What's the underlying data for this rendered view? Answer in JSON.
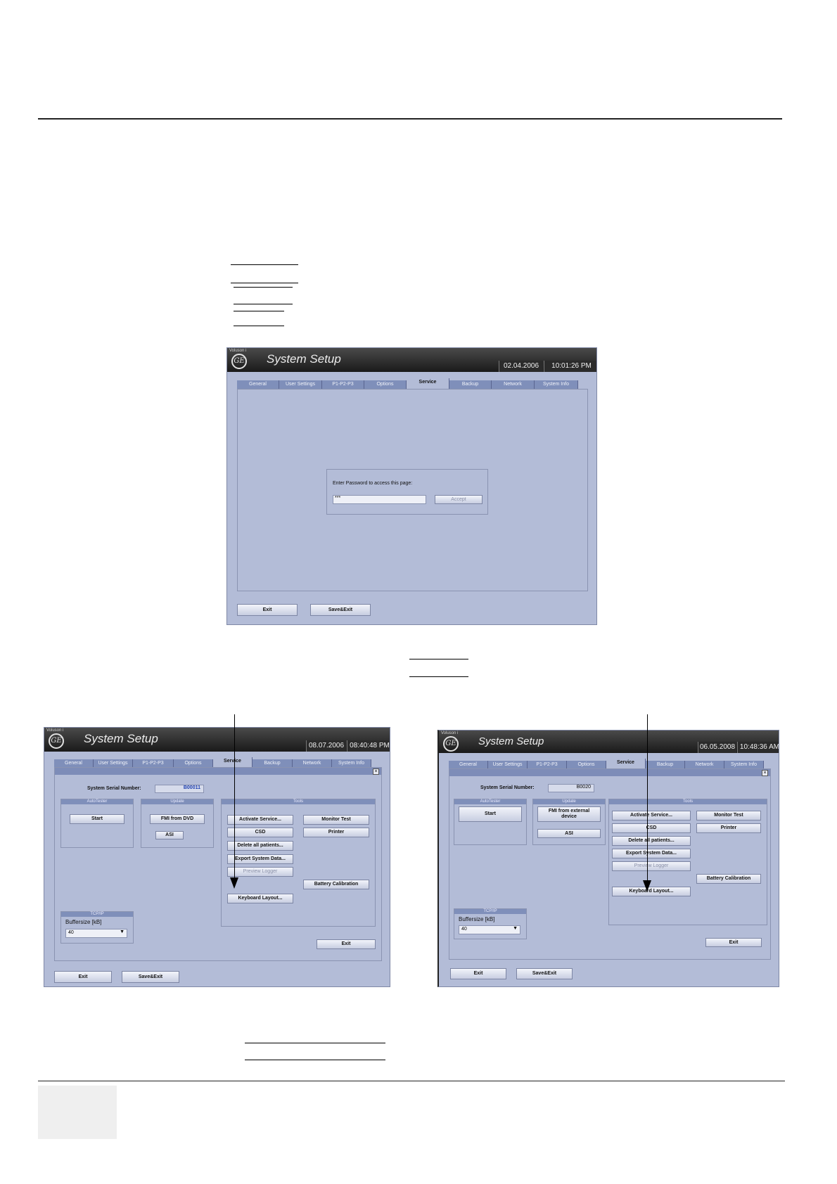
{
  "windows": {
    "top": {
      "brand": "Voluson i",
      "logo": "GE",
      "title": "System Setup",
      "date": "02.04.2006",
      "time": "10:01:26 PM",
      "tabs": [
        "General",
        "User Settings",
        "P1-P2-P3",
        "Options",
        "Service",
        "Backup",
        "Network",
        "System Info"
      ],
      "selected_tab": "Service",
      "password_prompt": "Enter Password to access this page:",
      "password_value": "***",
      "accept_label": "Accept",
      "exit_label": "Exit",
      "saveexit_label": "Save&Exit"
    },
    "left": {
      "brand": "Voluson i",
      "logo": "GE",
      "title": "System Setup",
      "date": "08.07.2006",
      "time": "08:40:48 PM",
      "tabs": [
        "General",
        "User Settings",
        "P1-P2-P3",
        "Options",
        "Service",
        "Backup",
        "Network",
        "System Info"
      ],
      "serial_label": "System Serial Number:",
      "serial_value": "B00011",
      "autotester_header": "AutoTester",
      "start_label": "Start",
      "update_header": "Update",
      "fmi_label": "FMI from DVD",
      "asi_label": "ASI",
      "tools_header": "Tools",
      "activate_label": "Activate Service...",
      "csd_label": "CSD",
      "delete_label": "Delete all patients...",
      "export_label": "Export System Data...",
      "preview_label": "Preview Logger",
      "keyboard_label": "Keyboard Layout...",
      "monitor_label": "Monitor Test",
      "printer_label": "Printer",
      "battery_label": "Battery Calibration",
      "tcpip_header": "TCP/IP",
      "buffer_label": "Buffersize [kB]",
      "buffer_value": "40",
      "inner_exit_label": "Exit",
      "exit_label": "Exit",
      "saveexit_label": "Save&Exit"
    },
    "right": {
      "brand": "Voluson i",
      "logo": "GE",
      "title": "System Setup",
      "date": "06.05.2008",
      "time": "10:48:36 AM",
      "tabs": [
        "General",
        "User Settings",
        "P1-P2-P3",
        "Options",
        "Service",
        "Backup",
        "Network",
        "System Info"
      ],
      "serial_label": "System Serial Number:",
      "serial_value": "B0020",
      "autotester_header": "AutoTester",
      "start_label": "Start",
      "update_header": "Update",
      "fmi_label": "FMI from external device",
      "asi_label": "ASI",
      "tools_header": "Tools",
      "activate_label": "Activate Service...",
      "csd_label": "CSD",
      "delete_label": "Delete all patients...",
      "export_label": "Export System Data...",
      "preview_label": "Preview Logger",
      "keyboard_label": "Keyboard Layout...",
      "monitor_label": "Monitor Test",
      "printer_label": "Printer",
      "battery_label": "Battery Calibration",
      "tcpip_header": "TCP/IP",
      "buffer_label": "Buffersize [kB]",
      "buffer_value": "40",
      "inner_exit_label": "Exit",
      "exit_label": "Exit",
      "saveexit_label": "Save&Exit"
    }
  }
}
